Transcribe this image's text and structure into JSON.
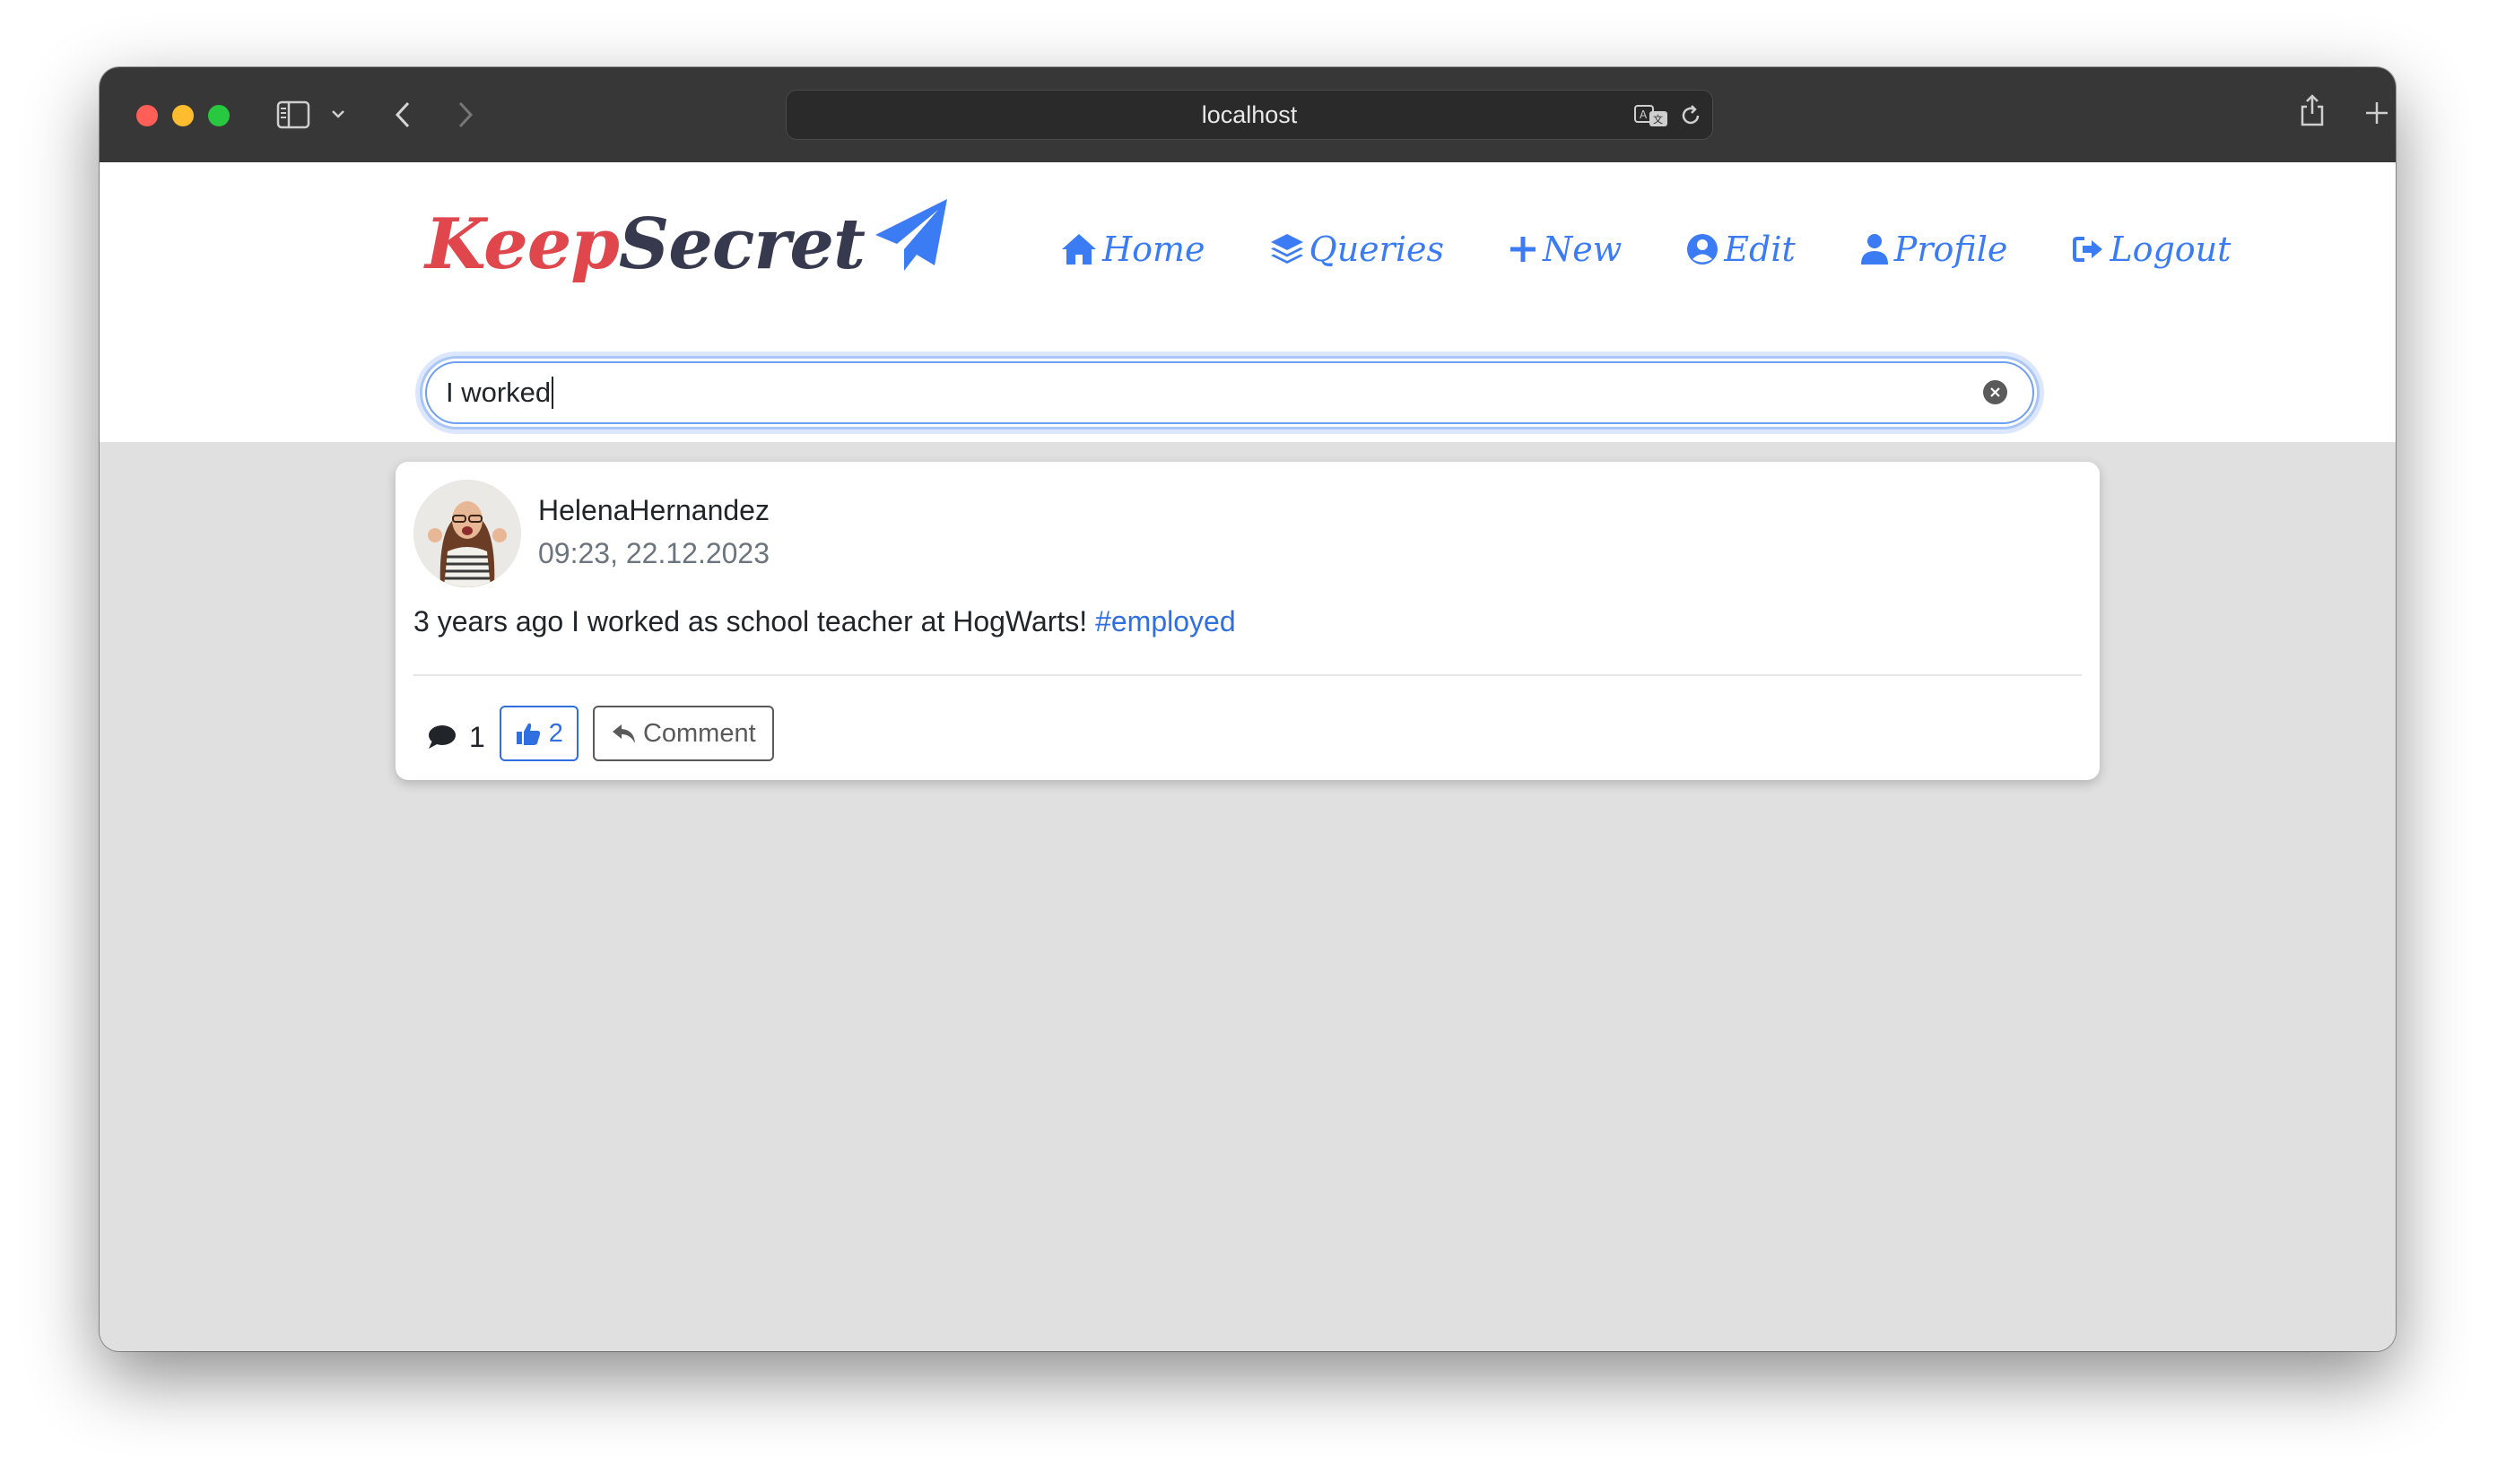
{
  "browser": {
    "url": "localhost"
  },
  "logo": {
    "part1": "Keep",
    "part2": "Secret"
  },
  "nav": {
    "home": "Home",
    "queries": "Queries",
    "new": "New",
    "edit": "Edit",
    "profile": "Profile",
    "logout": "Logout"
  },
  "search": {
    "value": "I worked"
  },
  "post": {
    "username": "HelenaHernandez",
    "timestamp": "09:23, 22.12.2023",
    "text": "3 years ago I worked as school teacher at HogWarts! ",
    "hashtag": "#employed",
    "comment_count": "1",
    "like_count": "2",
    "comment_label": "Comment"
  },
  "colors": {
    "accent": "#3b7cf5",
    "logo_red": "#e0474c",
    "logo_dark": "#373a4f",
    "page_bg": "#e0e0e0"
  }
}
